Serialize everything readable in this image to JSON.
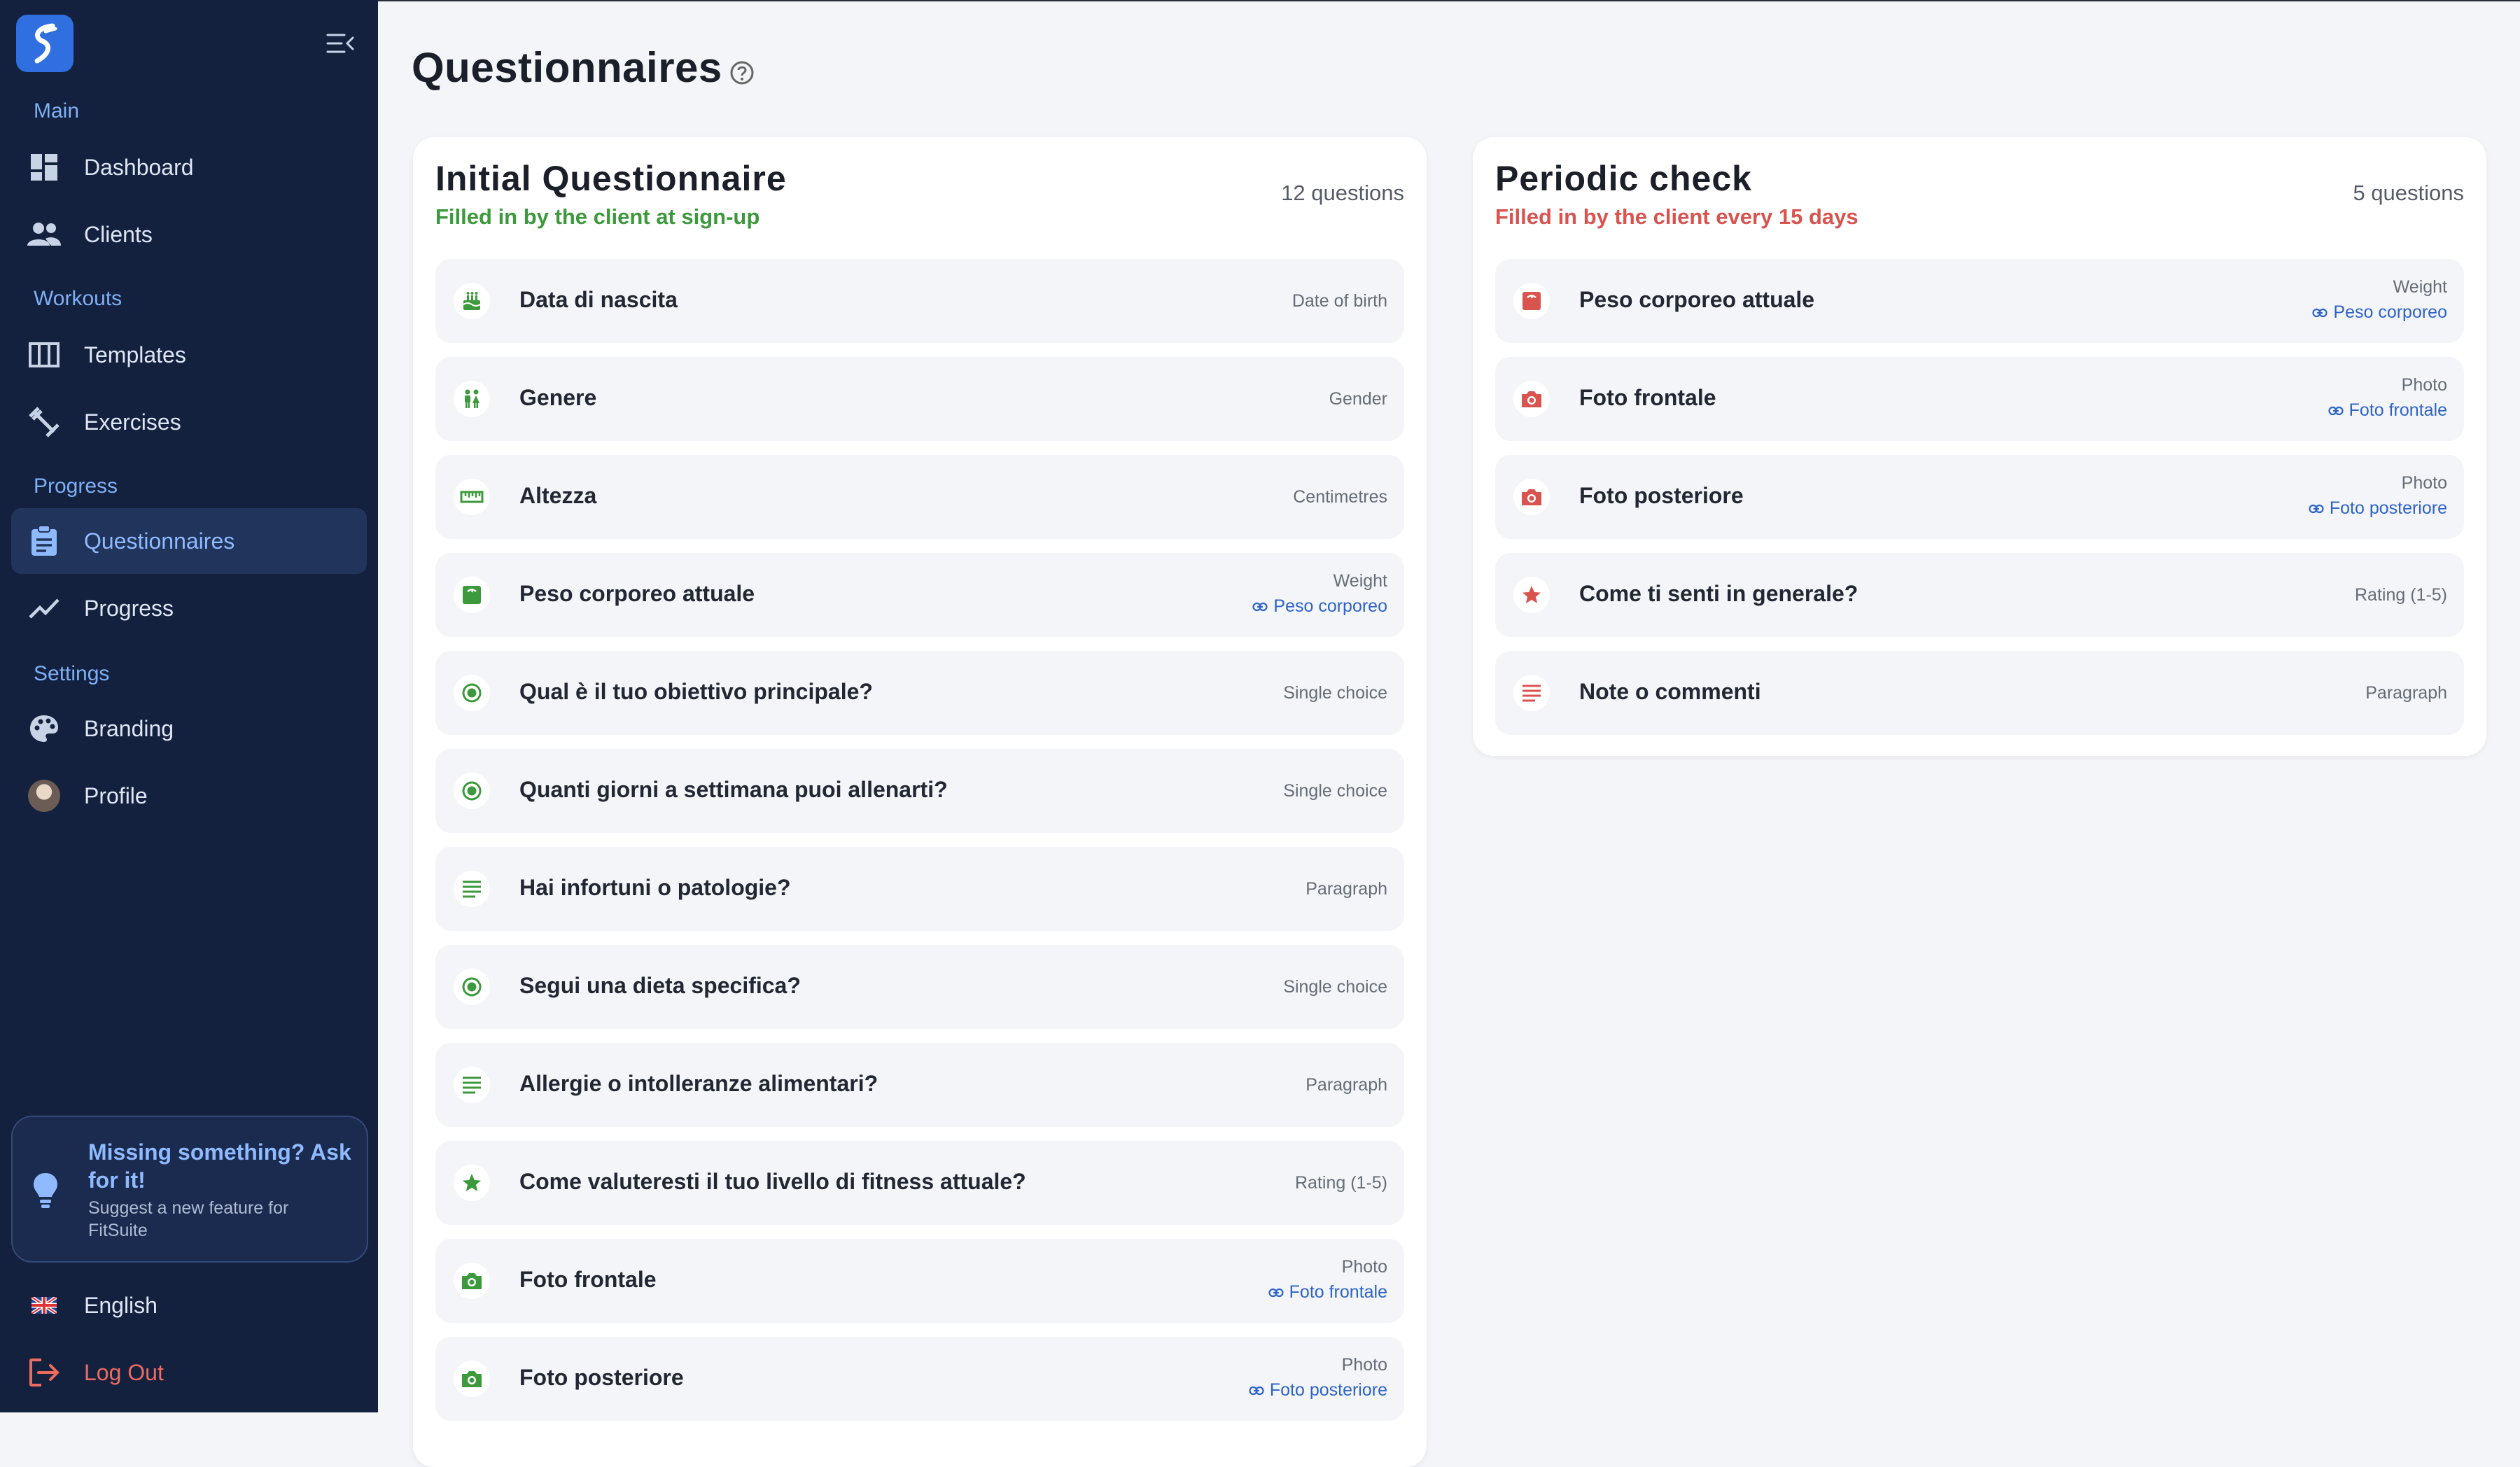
{
  "sidebar": {
    "sections": [
      "Main",
      "Workouts",
      "Progress",
      "Settings"
    ],
    "items": [
      {
        "label": "Dashboard"
      },
      {
        "label": "Clients"
      },
      {
        "label": "Templates"
      },
      {
        "label": "Exercises"
      },
      {
        "label": "Questionnaires",
        "active": true
      },
      {
        "label": "Progress"
      },
      {
        "label": "Branding"
      },
      {
        "label": "Profile"
      }
    ],
    "feature": {
      "title": "Missing something? Ask for it!",
      "subtitle": "Suggest a new feature for FitSuite"
    },
    "language": "English",
    "logout": "Log Out"
  },
  "page": {
    "title": "Questionnaires"
  },
  "colors": {
    "green": "#3c9a3c",
    "red": "#d9534f",
    "link": "#2d63c8",
    "sidebar_bg": "#13213f",
    "active_text": "#8fbaff"
  },
  "initial": {
    "title": "Initial Questionnaire",
    "subtitle": "Filled in by the client at sign-up",
    "count": "12 questions",
    "questions": [
      {
        "icon": "cake-icon",
        "label": "Data di nascita",
        "type": "Date of birth",
        "link": ""
      },
      {
        "icon": "gender-icon",
        "label": "Genere",
        "type": "Gender",
        "link": ""
      },
      {
        "icon": "ruler-icon",
        "label": "Altezza",
        "type": "Centimetres",
        "link": ""
      },
      {
        "icon": "scale-icon",
        "label": "Peso corporeo attuale",
        "type": "Weight",
        "link": "Peso corporeo"
      },
      {
        "icon": "radio-icon",
        "label": "Qual è il tuo obiettivo principale?",
        "type": "Single choice",
        "link": ""
      },
      {
        "icon": "radio-icon",
        "label": "Quanti giorni a settimana puoi allenarti?",
        "type": "Single choice",
        "link": ""
      },
      {
        "icon": "paragraph-icon",
        "label": "Hai infortuni o patologie?",
        "type": "Paragraph",
        "link": ""
      },
      {
        "icon": "radio-icon",
        "label": "Segui una dieta specifica?",
        "type": "Single choice",
        "link": ""
      },
      {
        "icon": "paragraph-icon",
        "label": "Allergie o intolleranze alimentari?",
        "type": "Paragraph",
        "link": ""
      },
      {
        "icon": "star-icon",
        "label": "Come valuteresti il tuo livello di fitness attuale?",
        "type": "Rating (1-5)",
        "link": ""
      },
      {
        "icon": "camera-icon",
        "label": "Foto frontale",
        "type": "Photo",
        "link": "Foto frontale"
      },
      {
        "icon": "camera-icon",
        "label": "Foto posteriore",
        "type": "Photo",
        "link": "Foto posteriore"
      }
    ]
  },
  "periodic": {
    "title": "Periodic check",
    "subtitle": "Filled in by the client every 15 days",
    "count": "5 questions",
    "questions": [
      {
        "icon": "scale-icon",
        "label": "Peso corporeo attuale",
        "type": "Weight",
        "link": "Peso corporeo"
      },
      {
        "icon": "camera-icon",
        "label": "Foto frontale",
        "type": "Photo",
        "link": "Foto frontale"
      },
      {
        "icon": "camera-icon",
        "label": "Foto posteriore",
        "type": "Photo",
        "link": "Foto posteriore"
      },
      {
        "icon": "star-icon",
        "label": "Come ti senti in generale?",
        "type": "Rating (1-5)",
        "link": ""
      },
      {
        "icon": "paragraph-icon",
        "label": "Note o commenti",
        "type": "Paragraph",
        "link": ""
      }
    ]
  }
}
